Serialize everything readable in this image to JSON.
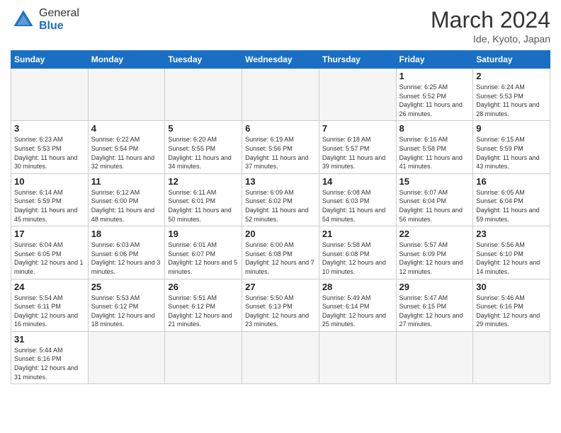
{
  "header": {
    "logo_general": "General",
    "logo_blue": "Blue",
    "month_year": "March 2024",
    "location": "Ide, Kyoto, Japan"
  },
  "weekdays": [
    "Sunday",
    "Monday",
    "Tuesday",
    "Wednesday",
    "Thursday",
    "Friday",
    "Saturday"
  ],
  "weeks": [
    [
      {
        "day": "",
        "info": ""
      },
      {
        "day": "",
        "info": ""
      },
      {
        "day": "",
        "info": ""
      },
      {
        "day": "",
        "info": ""
      },
      {
        "day": "",
        "info": ""
      },
      {
        "day": "1",
        "info": "Sunrise: 6:25 AM\nSunset: 5:52 PM\nDaylight: 11 hours and 26 minutes."
      },
      {
        "day": "2",
        "info": "Sunrise: 6:24 AM\nSunset: 5:53 PM\nDaylight: 11 hours and 28 minutes."
      }
    ],
    [
      {
        "day": "3",
        "info": "Sunrise: 6:23 AM\nSunset: 5:53 PM\nDaylight: 11 hours and 30 minutes."
      },
      {
        "day": "4",
        "info": "Sunrise: 6:22 AM\nSunset: 5:54 PM\nDaylight: 11 hours and 32 minutes."
      },
      {
        "day": "5",
        "info": "Sunrise: 6:20 AM\nSunset: 5:55 PM\nDaylight: 11 hours and 34 minutes."
      },
      {
        "day": "6",
        "info": "Sunrise: 6:19 AM\nSunset: 5:56 PM\nDaylight: 11 hours and 37 minutes."
      },
      {
        "day": "7",
        "info": "Sunrise: 6:18 AM\nSunset: 5:57 PM\nDaylight: 11 hours and 39 minutes."
      },
      {
        "day": "8",
        "info": "Sunrise: 6:16 AM\nSunset: 5:58 PM\nDaylight: 11 hours and 41 minutes."
      },
      {
        "day": "9",
        "info": "Sunrise: 6:15 AM\nSunset: 5:59 PM\nDaylight: 11 hours and 43 minutes."
      }
    ],
    [
      {
        "day": "10",
        "info": "Sunrise: 6:14 AM\nSunset: 5:59 PM\nDaylight: 11 hours and 45 minutes."
      },
      {
        "day": "11",
        "info": "Sunrise: 6:12 AM\nSunset: 6:00 PM\nDaylight: 11 hours and 48 minutes."
      },
      {
        "day": "12",
        "info": "Sunrise: 6:11 AM\nSunset: 6:01 PM\nDaylight: 11 hours and 50 minutes."
      },
      {
        "day": "13",
        "info": "Sunrise: 6:09 AM\nSunset: 6:02 PM\nDaylight: 11 hours and 52 minutes."
      },
      {
        "day": "14",
        "info": "Sunrise: 6:08 AM\nSunset: 6:03 PM\nDaylight: 11 hours and 54 minutes."
      },
      {
        "day": "15",
        "info": "Sunrise: 6:07 AM\nSunset: 6:04 PM\nDaylight: 11 hours and 56 minutes."
      },
      {
        "day": "16",
        "info": "Sunrise: 6:05 AM\nSunset: 6:04 PM\nDaylight: 11 hours and 59 minutes."
      }
    ],
    [
      {
        "day": "17",
        "info": "Sunrise: 6:04 AM\nSunset: 6:05 PM\nDaylight: 12 hours and 1 minute."
      },
      {
        "day": "18",
        "info": "Sunrise: 6:03 AM\nSunset: 6:06 PM\nDaylight: 12 hours and 3 minutes."
      },
      {
        "day": "19",
        "info": "Sunrise: 6:01 AM\nSunset: 6:07 PM\nDaylight: 12 hours and 5 minutes."
      },
      {
        "day": "20",
        "info": "Sunrise: 6:00 AM\nSunset: 6:08 PM\nDaylight: 12 hours and 7 minutes."
      },
      {
        "day": "21",
        "info": "Sunrise: 5:58 AM\nSunset: 6:08 PM\nDaylight: 12 hours and 10 minutes."
      },
      {
        "day": "22",
        "info": "Sunrise: 5:57 AM\nSunset: 6:09 PM\nDaylight: 12 hours and 12 minutes."
      },
      {
        "day": "23",
        "info": "Sunrise: 5:56 AM\nSunset: 6:10 PM\nDaylight: 12 hours and 14 minutes."
      }
    ],
    [
      {
        "day": "24",
        "info": "Sunrise: 5:54 AM\nSunset: 6:11 PM\nDaylight: 12 hours and 16 minutes."
      },
      {
        "day": "25",
        "info": "Sunrise: 5:53 AM\nSunset: 6:12 PM\nDaylight: 12 hours and 18 minutes."
      },
      {
        "day": "26",
        "info": "Sunrise: 5:51 AM\nSunset: 6:12 PM\nDaylight: 12 hours and 21 minutes."
      },
      {
        "day": "27",
        "info": "Sunrise: 5:50 AM\nSunset: 6:13 PM\nDaylight: 12 hours and 23 minutes."
      },
      {
        "day": "28",
        "info": "Sunrise: 5:49 AM\nSunset: 6:14 PM\nDaylight: 12 hours and 25 minutes."
      },
      {
        "day": "29",
        "info": "Sunrise: 5:47 AM\nSunset: 6:15 PM\nDaylight: 12 hours and 27 minutes."
      },
      {
        "day": "30",
        "info": "Sunrise: 5:46 AM\nSunset: 6:16 PM\nDaylight: 12 hours and 29 minutes."
      }
    ],
    [
      {
        "day": "31",
        "info": "Sunrise: 5:44 AM\nSunset: 6:16 PM\nDaylight: 12 hours and 31 minutes."
      },
      {
        "day": "",
        "info": ""
      },
      {
        "day": "",
        "info": ""
      },
      {
        "day": "",
        "info": ""
      },
      {
        "day": "",
        "info": ""
      },
      {
        "day": "",
        "info": ""
      },
      {
        "day": "",
        "info": ""
      }
    ]
  ]
}
